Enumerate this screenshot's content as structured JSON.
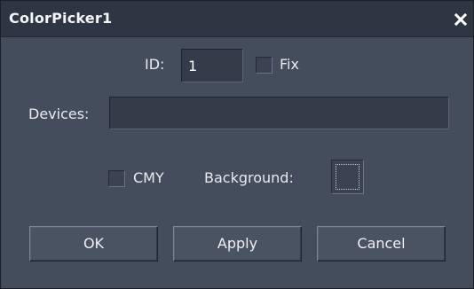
{
  "window": {
    "title": "ColorPicker1",
    "close_icon": "close-x-icon"
  },
  "id_row": {
    "id_label": "ID:",
    "id_value": "1",
    "fix_label": "Fix",
    "fix_checked": false
  },
  "devices_row": {
    "devices_label": "Devices:",
    "devices_value": ""
  },
  "options_row": {
    "cmy_label": "CMY",
    "cmy_checked": false,
    "background_label": "Background:"
  },
  "buttons": {
    "ok_label": "OK",
    "apply_label": "Apply",
    "cancel_label": "Cancel"
  },
  "colors": {
    "titlebar": "#2e3644",
    "body": "#444d5c",
    "field": "#343c4a",
    "text": "#e8ebef"
  }
}
